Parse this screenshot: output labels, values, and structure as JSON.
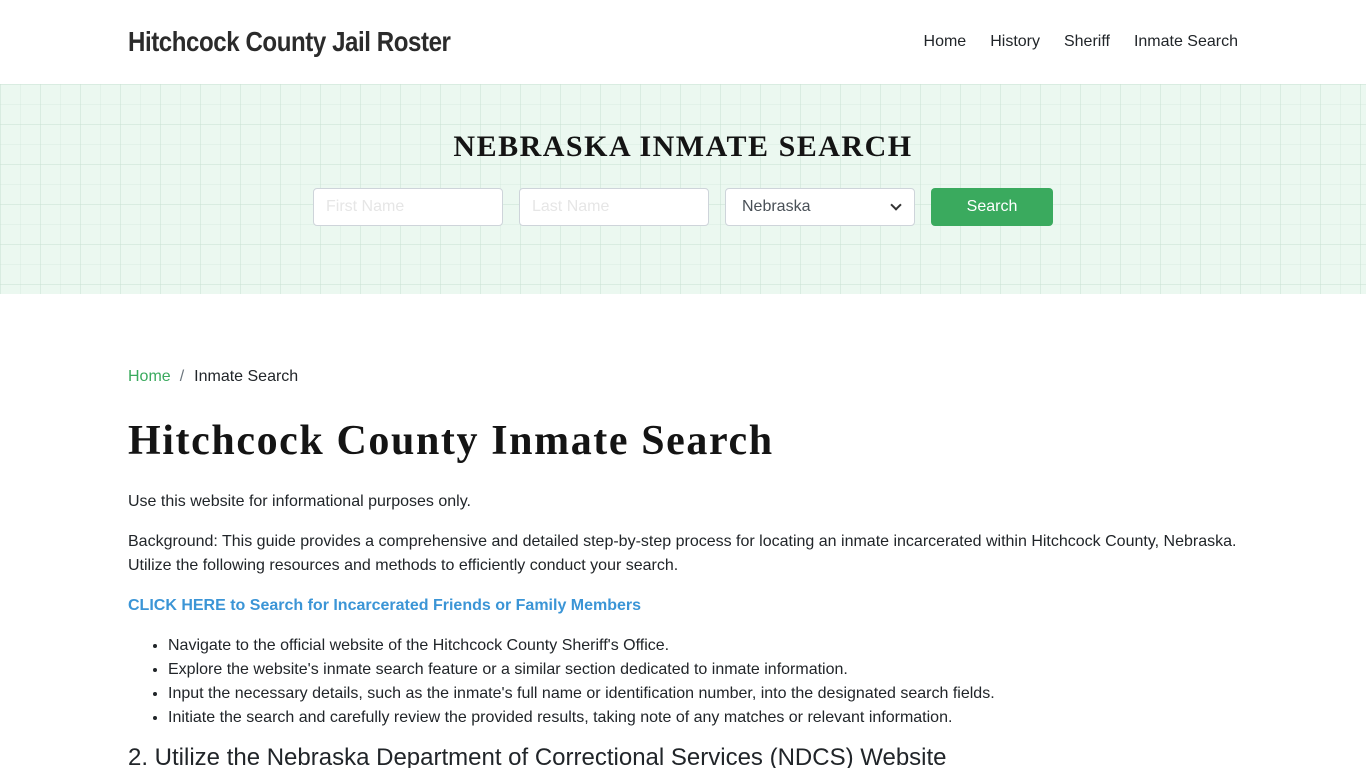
{
  "site": {
    "brand": "Hitchcock County Jail Roster"
  },
  "nav": {
    "items": [
      {
        "label": "Home"
      },
      {
        "label": "History"
      },
      {
        "label": "Sheriff"
      },
      {
        "label": "Inmate Search"
      }
    ]
  },
  "hero": {
    "title": "NEBRASKA INMATE SEARCH",
    "first_name_placeholder": "First Name",
    "first_name_value": "",
    "last_name_placeholder": "Last Name",
    "last_name_value": "",
    "state_selected": "Nebraska",
    "search_label": "Search",
    "accent_color": "#3aaa5e"
  },
  "breadcrumb": {
    "home": "Home",
    "separator": "/",
    "current": "Inmate Search"
  },
  "main": {
    "title": "Hitchcock County Inmate Search",
    "disclaimer": "Use this website for informational purposes only.",
    "background": "Background: This guide provides a comprehensive and detailed step-by-step process for locating an inmate incarcerated within Hitchcock County, Nebraska. Utilize the following resources and methods to efficiently conduct your search.",
    "cta_link": "CLICK HERE to Search for Incarcerated Friends or Family Members",
    "steps": [
      "Navigate to the official website of the Hitchcock County Sheriff's Office.",
      "Explore the website's inmate search feature or a similar section dedicated to inmate information.",
      "Input the necessary details, such as the inmate's full name or identification number, into the designated search fields.",
      "Initiate the search and carefully review the provided results, taking note of any matches or relevant information."
    ],
    "next_heading": "2. Utilize the Nebraska Department of Correctional Services (NDCS) Website"
  }
}
